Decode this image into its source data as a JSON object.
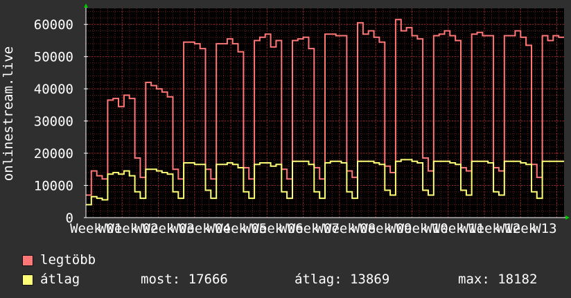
{
  "colors": {
    "background": "#2f2f2f",
    "plot_background": "#000000",
    "grid": "#6b1f1f",
    "axis": "#ffffff",
    "arrow": "#00cc00",
    "max_series": "#ff7777",
    "avg_series": "#ffff77"
  },
  "legend": {
    "max_label": "legtöbb",
    "avg_label": "átlag",
    "most": "most: 17666",
    "avg": "átlag: 13869",
    "max": "max: 18182"
  },
  "chart_data": {
    "type": "line",
    "ylabel": "onlinestream.live",
    "ylim": [
      0,
      65000
    ],
    "yticks": [
      0,
      10000,
      20000,
      30000,
      40000,
      50000,
      60000
    ],
    "ytick_labels": [
      "0",
      "10000",
      "20000",
      "30000",
      "40000",
      "50000",
      "60000"
    ],
    "xlim": [
      0,
      13.2
    ],
    "xtick_labels": [
      "Week",
      "W01",
      "Week",
      "W02",
      "Week",
      "W03",
      "Week",
      "W04",
      "Week",
      "W05",
      "Week",
      "W06",
      "Week",
      "W07",
      "Week",
      "W08",
      "Week",
      "W09",
      "Week",
      "W10",
      "Week",
      "W11",
      "Week",
      "W12",
      "Week",
      "W13"
    ],
    "grid": true,
    "series": [
      {
        "name": "legtöbb",
        "values": [
          7000,
          14500,
          13000,
          12000,
          36500,
          37000,
          34500,
          38000,
          37000,
          18500,
          12500,
          42000,
          41000,
          40000,
          39000,
          37500,
          15000,
          12000,
          54500,
          54500,
          54000,
          52500,
          15000,
          12000,
          54000,
          54000,
          55500,
          54000,
          51500,
          15500,
          12000,
          55000,
          56000,
          57000,
          53000,
          55000,
          15000,
          12000,
          55000,
          55500,
          56000,
          52500,
          15500,
          12000,
          57000,
          57000,
          56500,
          56500,
          14500,
          12500,
          60500,
          57000,
          58000,
          56000,
          54500,
          16000,
          14000,
          61500,
          58000,
          59000,
          56500,
          55500,
          18500,
          14500,
          56500,
          57000,
          58000,
          56500,
          55000,
          15500,
          14500,
          57000,
          57500,
          56500,
          56500,
          15500,
          14500,
          56500,
          56500,
          58000,
          56000,
          53500,
          16500,
          12500,
          56500,
          55000,
          56500,
          56000
        ]
      },
      {
        "name": "átlag",
        "values": [
          4000,
          6500,
          6000,
          5500,
          13500,
          14000,
          13500,
          14500,
          13000,
          8000,
          6000,
          15000,
          15000,
          14500,
          14000,
          13500,
          8000,
          6000,
          17000,
          17000,
          16500,
          16500,
          8500,
          6000,
          16500,
          16500,
          17000,
          16500,
          15500,
          8000,
          6000,
          16500,
          17000,
          17000,
          16000,
          16500,
          8000,
          6000,
          17500,
          17500,
          17500,
          16500,
          8000,
          6000,
          17000,
          17500,
          17500,
          17000,
          8000,
          6000,
          17500,
          17500,
          17500,
          17000,
          16500,
          8500,
          7000,
          17500,
          18000,
          18000,
          17500,
          17000,
          8500,
          7000,
          17500,
          17500,
          17500,
          17000,
          16500,
          8500,
          7000,
          17500,
          17500,
          17500,
          17000,
          8000,
          7000,
          17500,
          17500,
          17500,
          17000,
          16500,
          8000,
          6000,
          17500,
          17500,
          17500,
          17500
        ]
      }
    ]
  }
}
